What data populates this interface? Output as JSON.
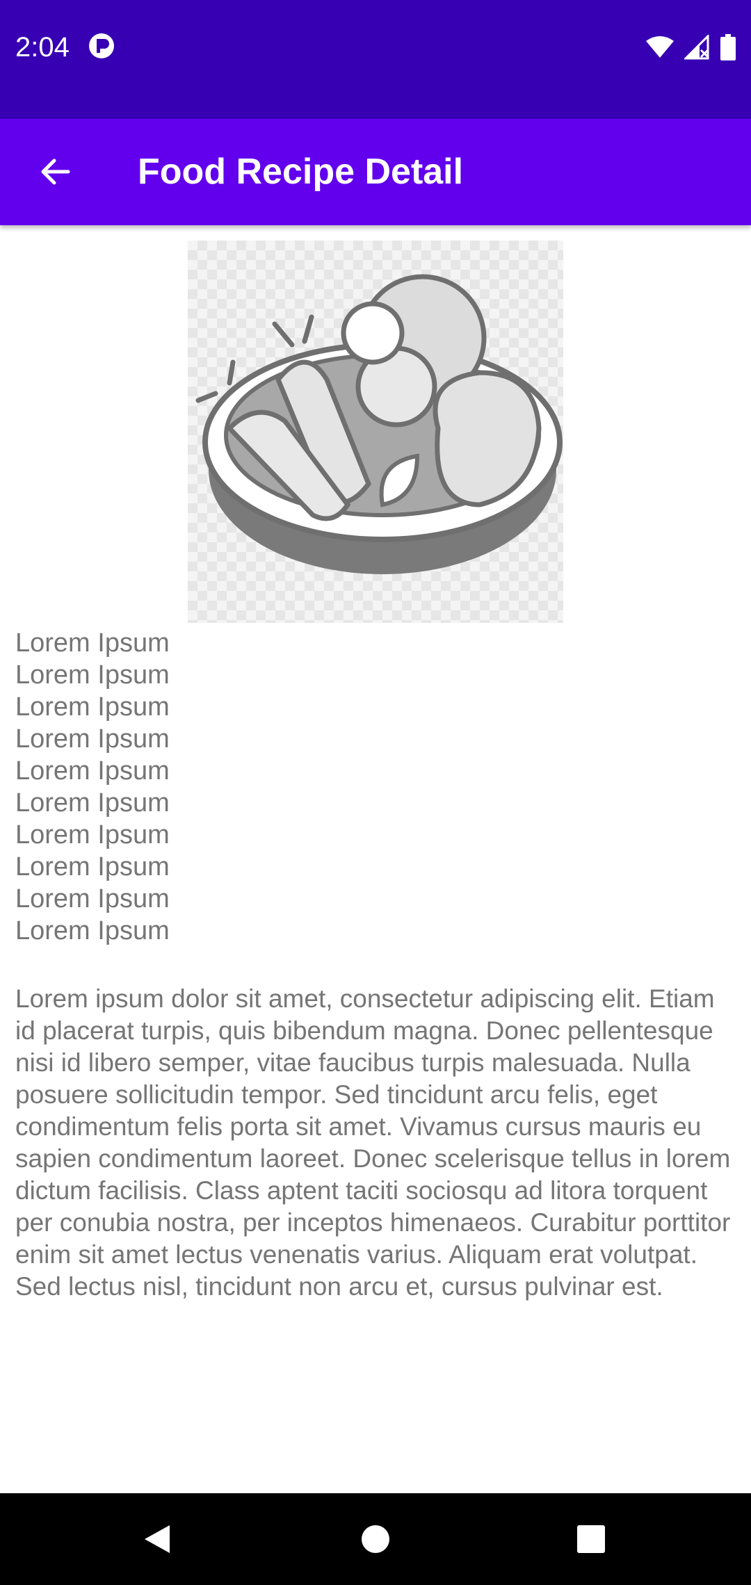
{
  "status_bar": {
    "time": "2:04",
    "app_icon": "notification-app-icon",
    "icons": [
      "wifi-icon",
      "signal-icon",
      "battery-icon"
    ]
  },
  "app_bar": {
    "title": "Food Recipe Detail",
    "back_icon": "arrow-back-icon",
    "color": "#6200ee",
    "status_color": "#3700b3"
  },
  "recipe": {
    "image_icon": "food-bowl-illustration",
    "ingredients": [
      "Lorem Ipsum",
      "Lorem Ipsum",
      "Lorem Ipsum",
      "Lorem Ipsum",
      "Lorem Ipsum",
      "Lorem Ipsum",
      "Lorem Ipsum",
      "Lorem Ipsum",
      "Lorem Ipsum",
      "Lorem Ipsum"
    ],
    "description": "Lorem ipsum dolor sit amet, consectetur adipiscing elit. Etiam id placerat turpis, quis bibendum magna. Donec pellentesque nisi id libero semper, vitae faucibus turpis malesuada. Nulla posuere sollicitudin tempor. Sed tincidunt arcu felis, eget condimentum felis porta sit amet. Vivamus cursus mauris eu sapien condimentum laoreet. Donec scelerisque tellus in lorem dictum facilisis. Class aptent taciti sociosqu ad litora torquent per conubia nostra, per inceptos himenaeos. Curabitur porttitor enim sit amet lectus venenatis varius. Aliquam erat volutpat. Sed lectus nisl, tincidunt non arcu et, cursus pulvinar est."
  },
  "nav_bar": {
    "buttons": [
      "back-triangle-icon",
      "home-circle-icon",
      "recents-square-icon"
    ]
  }
}
